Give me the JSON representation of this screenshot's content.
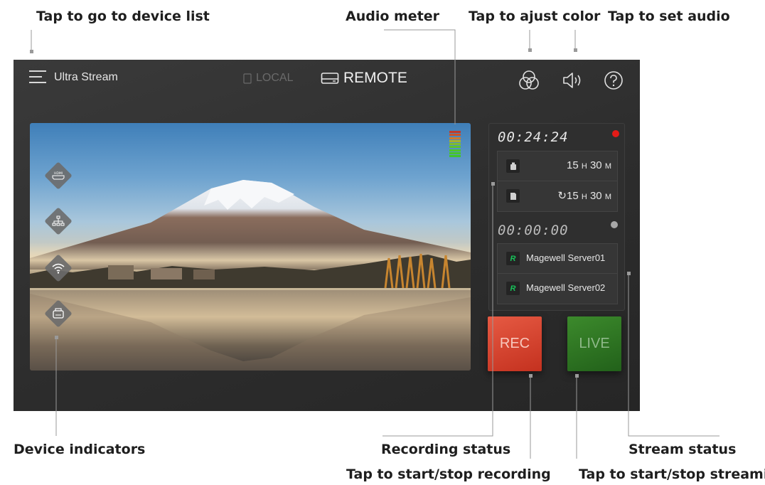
{
  "callouts": {
    "device_list": "Tap to go to device list",
    "audio_meter": "Audio meter",
    "color": "Tap to ajust color",
    "audio": "Tap to set audio",
    "device_indicators": "Device indicators",
    "recording_status": "Recording status",
    "stream_status": "Stream status",
    "start_stop_recording": "Tap to start/stop recording",
    "start_stop_streaming": "Tap to start/stop streaming"
  },
  "app": {
    "title": "Ultra Stream",
    "mode_local": "LOCAL",
    "mode_remote": "REMOTE",
    "active_mode": "REMOTE"
  },
  "indicators": [
    {
      "icon": "hdmi-icon",
      "label": "HDMI"
    },
    {
      "icon": "network-icon",
      "label": ""
    },
    {
      "icon": "wifi-icon",
      "label": ""
    },
    {
      "icon": "usb-drive-icon",
      "label": ""
    }
  ],
  "recording": {
    "timer": "00:24:24",
    "indicator_color": "#e41b17",
    "destinations": [
      {
        "icon": "usb-drive-icon",
        "value": "15",
        "h": "H",
        "minutes": "30",
        "m": "M",
        "loop": false
      },
      {
        "icon": "sd-card-icon",
        "value": "15",
        "h": "H",
        "minutes": "30",
        "m": "M",
        "loop": true
      }
    ]
  },
  "streaming": {
    "timer": "00:00:00",
    "indicator_color": "#a8a8a8",
    "servers": [
      {
        "badge": "R",
        "name": "Magewell Server01"
      },
      {
        "badge": "R",
        "name": "Magewell Server02"
      }
    ]
  },
  "buttons": {
    "rec": "REC",
    "live": "LIVE"
  },
  "colors": {
    "rec": "#d9432f",
    "live": "#2f7a24",
    "badge": "#18c35a"
  }
}
